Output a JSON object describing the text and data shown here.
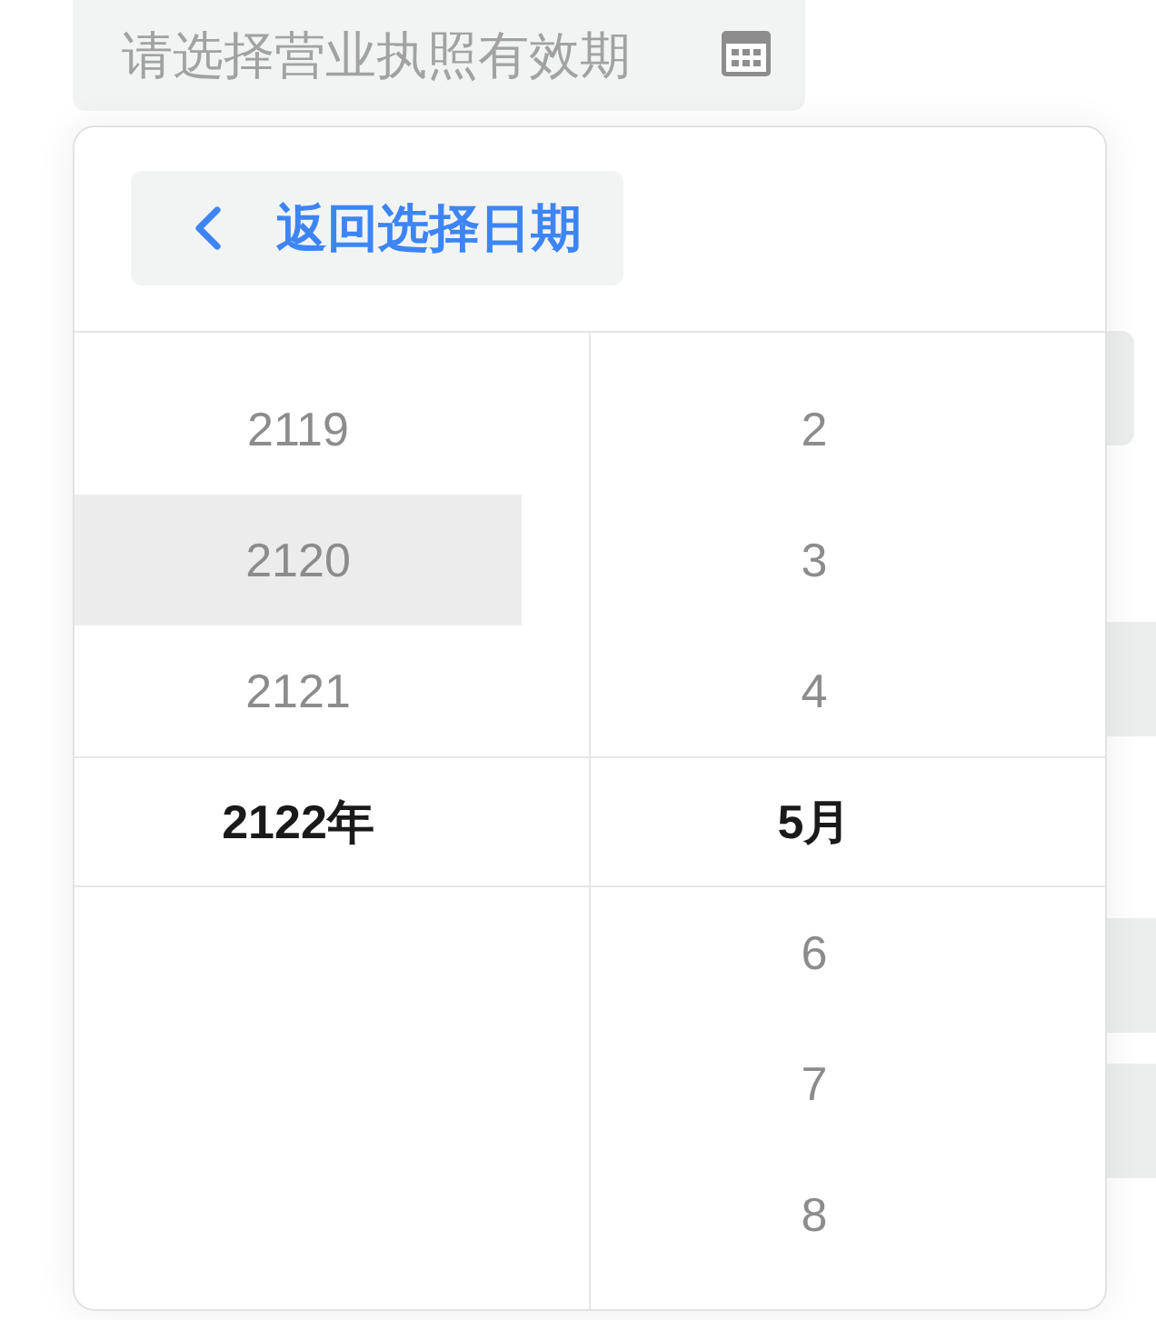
{
  "date_field": {
    "placeholder": "请选择营业执照有效期"
  },
  "picker": {
    "back_button": {
      "label": "返回选择日期"
    },
    "columns": [
      {
        "items": [
          {
            "label": "2119",
            "selected": false,
            "hovered": false
          },
          {
            "label": "2120",
            "selected": false,
            "hovered": true
          },
          {
            "label": "2121",
            "selected": false,
            "hovered": false
          },
          {
            "label": "2122年",
            "selected": true,
            "hovered": false
          }
        ]
      },
      {
        "items": [
          {
            "label": "2",
            "selected": false,
            "hovered": false
          },
          {
            "label": "3",
            "selected": false,
            "hovered": false
          },
          {
            "label": "4",
            "selected": false,
            "hovered": false
          },
          {
            "label": "5月",
            "selected": true,
            "hovered": false
          },
          {
            "label": "6",
            "selected": false,
            "hovered": false
          },
          {
            "label": "7",
            "selected": false,
            "hovered": false
          },
          {
            "label": "8",
            "selected": false,
            "hovered": false
          }
        ]
      }
    ]
  }
}
